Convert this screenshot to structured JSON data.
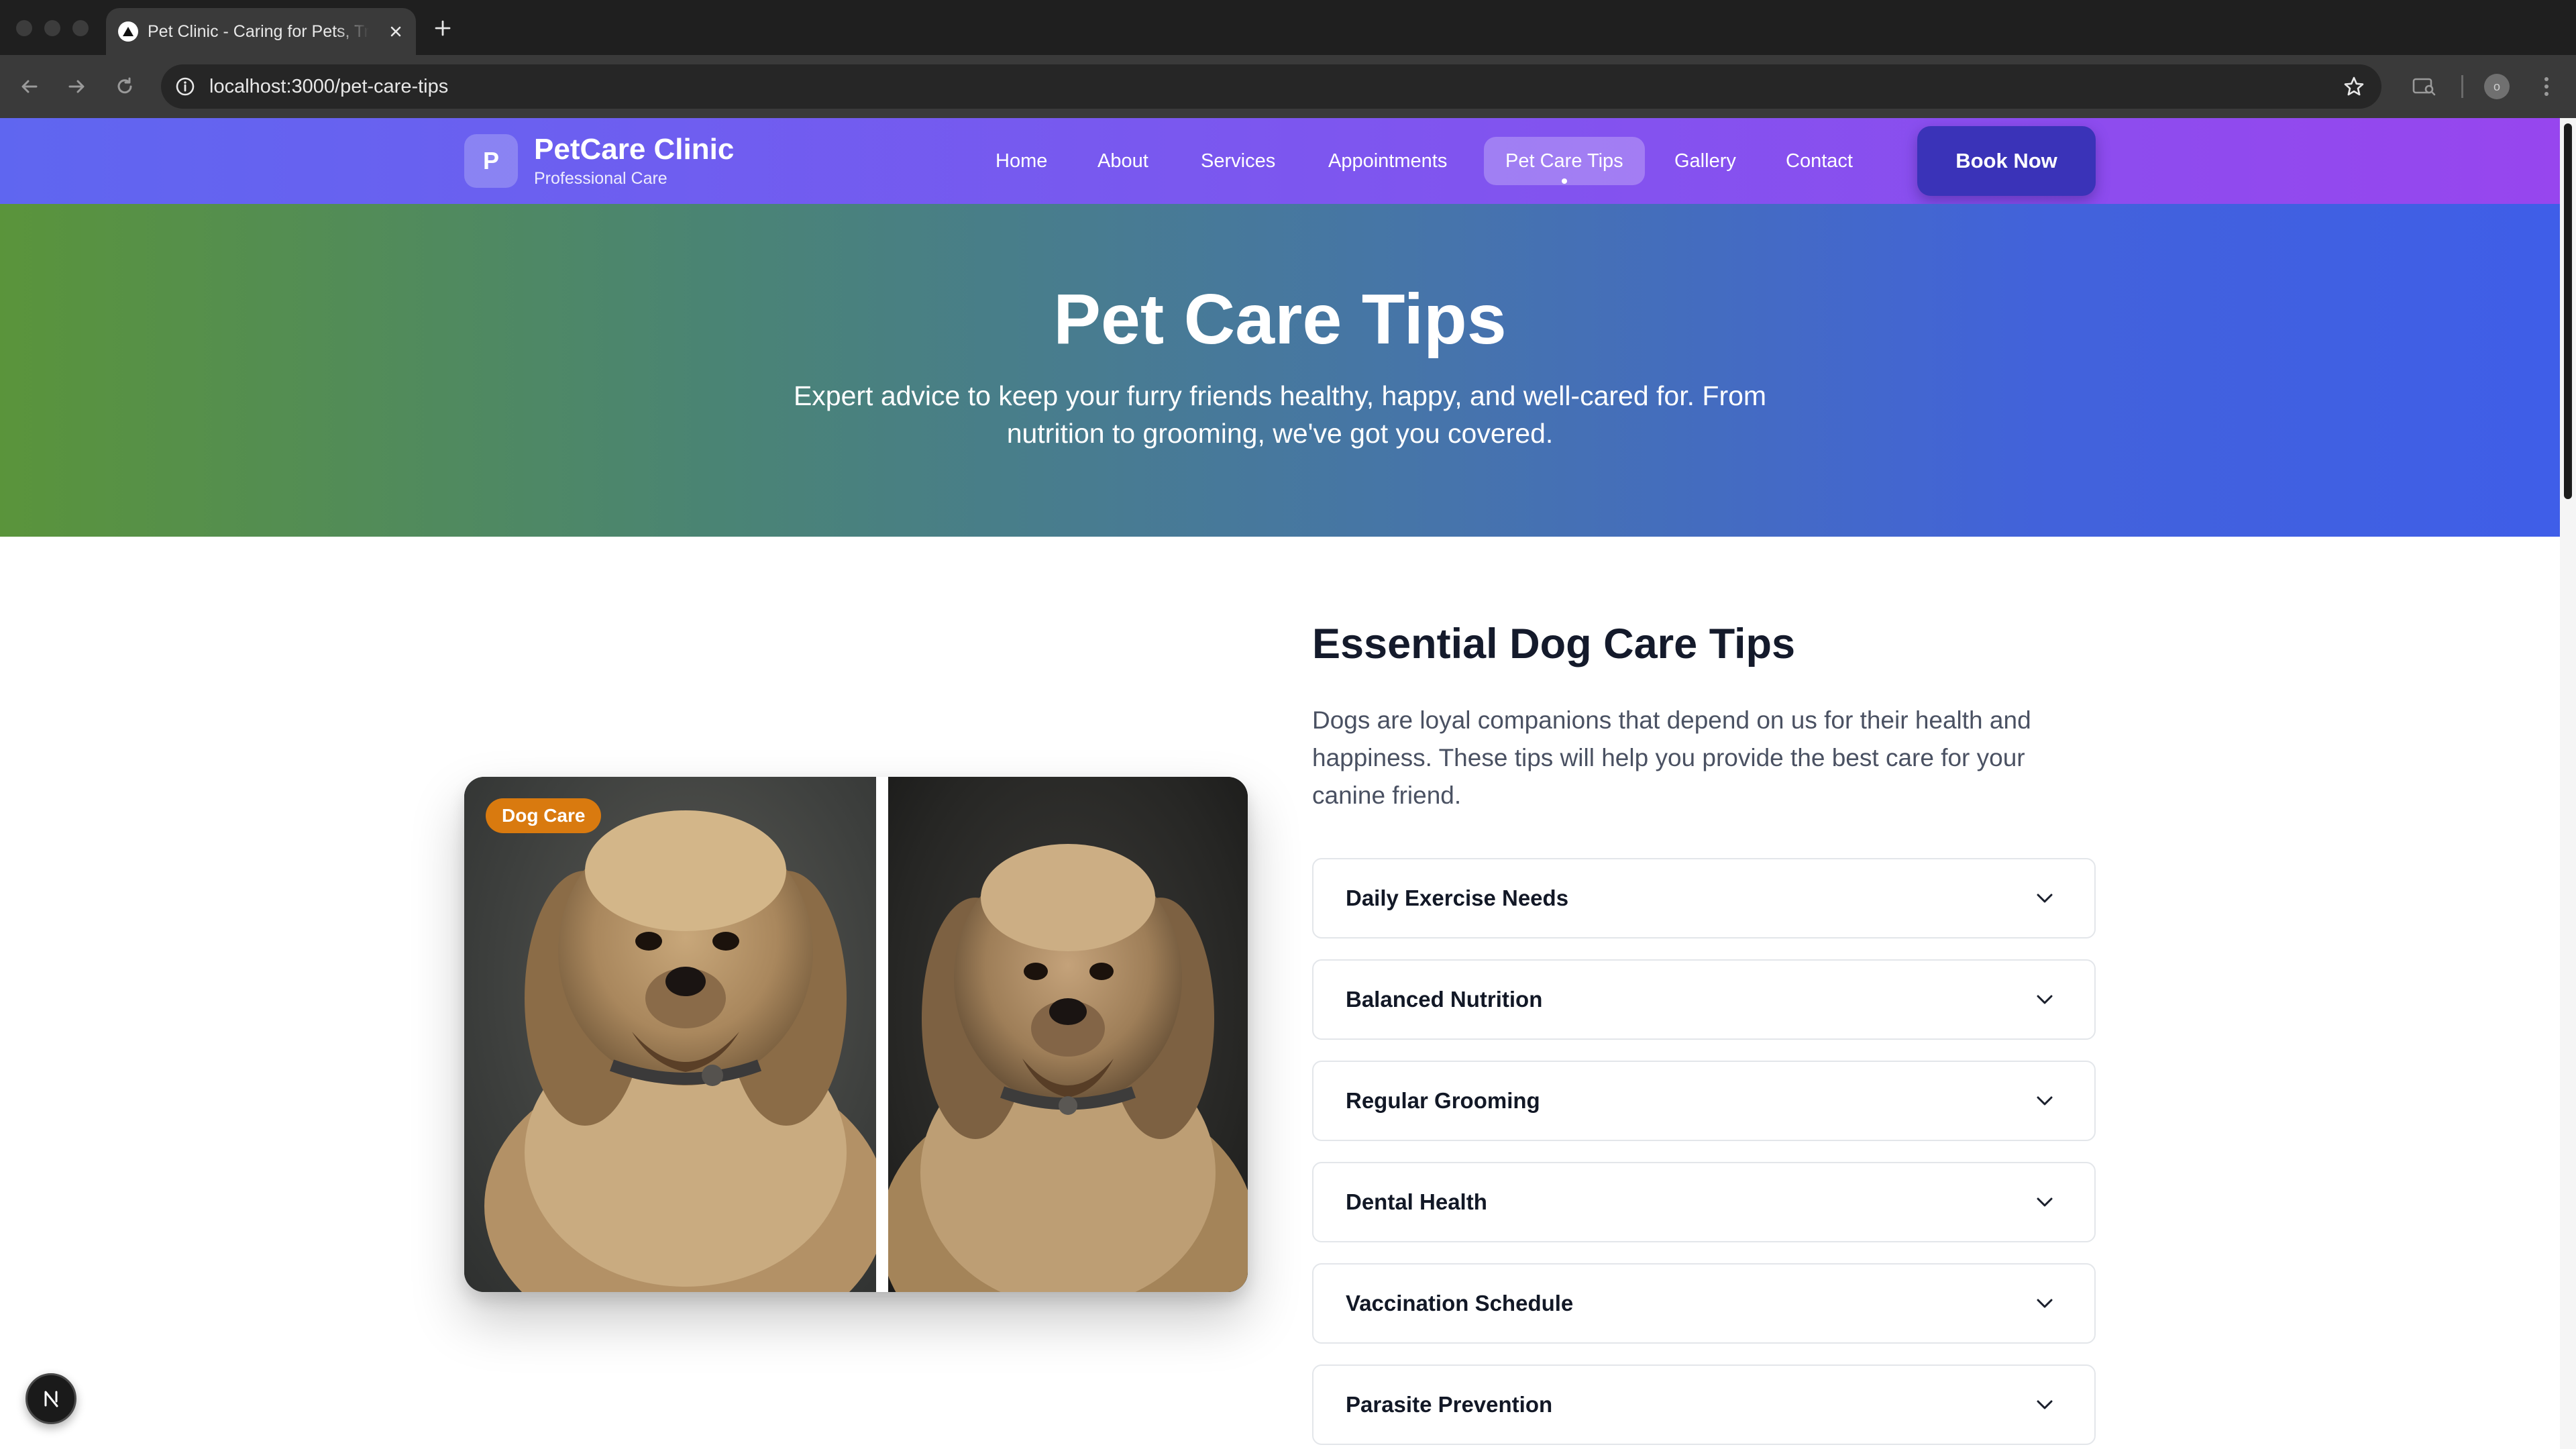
{
  "browser": {
    "tab_title": "Pet Clinic - Caring for Pets, Treating with Love",
    "url": "localhost:3000/pet-care-tips",
    "profile_initial": "o"
  },
  "site": {
    "brand_initial": "P",
    "brand_name": "PetCare Clinic",
    "brand_tagline": "Professional Care",
    "nav": [
      "Home",
      "About",
      "Services",
      "Appointments",
      "Pet Care Tips",
      "Gallery",
      "Contact"
    ],
    "active_nav": "Pet Care Tips",
    "cta": "Book Now"
  },
  "hero": {
    "title": "Pet Care Tips",
    "subtitle": "Expert advice to keep your furry friends healthy, happy, and well-cared for. From nutrition to grooming, we've got you covered."
  },
  "section": {
    "badge": "Dog Care",
    "title": "Essential Dog Care Tips",
    "description": "Dogs are loyal companions that depend on us for their health and happiness. These tips will help you provide the best care for your canine friend.",
    "accordion": [
      "Daily Exercise Needs",
      "Balanced Nutrition",
      "Regular Grooming",
      "Dental Health",
      "Vaccination Schedule",
      "Parasite Prevention"
    ]
  },
  "colors": {
    "header_gradient": [
      "#5f66f0",
      "#9746ee"
    ],
    "hero_gradient": [
      "#5a943b",
      "#3f5ee8"
    ],
    "cta_bg": "#3a33b8",
    "badge_bg": "#d97a0f"
  },
  "icons": [
    "back-arrow-icon",
    "forward-arrow-icon",
    "reload-icon",
    "info-icon",
    "star-icon",
    "chevron-down-icon",
    "nextjs-icon"
  ]
}
